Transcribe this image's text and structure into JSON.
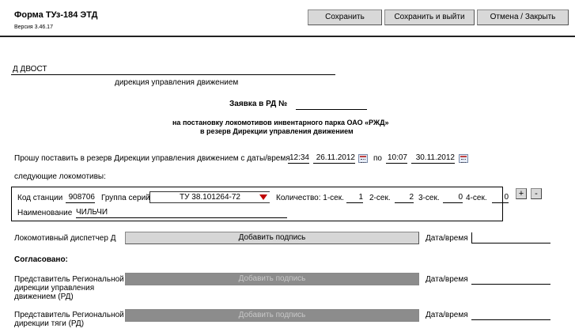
{
  "header": {
    "title": "Форма ТУз-184 ЭТД",
    "version": "Версия 3.46.17"
  },
  "toolbar": {
    "save_label": "Сохранить",
    "save_exit_label": "Сохранить и выйти",
    "cancel_label": "Отмена / Закрыть"
  },
  "form": {
    "depot_code": "Д ДВОСТ",
    "directorate_caption": "дирекция управления движением",
    "request_title": "Заявка в РД №",
    "request_number": "",
    "subtitle_line1": "на постановку  локомотивов  инвентарного парка ОАО «РЖД»",
    "subtitle_line2": "в резерв Дирекции управления движением",
    "request_text": "Прошу  поставить в резерв Дирекции управления движением с даты/время",
    "from_time": "12:34",
    "from_date": "26.11.2012",
    "to_label": "по",
    "to_time": "10:07",
    "to_date": "30.11.2012",
    "following_text": "следующие локомотивы:"
  },
  "locomotive": {
    "station_label": "Код станции",
    "station_code": "908706",
    "series_group_label": "Группа серий",
    "series_group_value": "ТУ 38.101264-72",
    "quantity_label": "Количество: 1-сек.",
    "sec1_value": "1",
    "sec2_label": "2-сек.",
    "sec2_value": "2",
    "sec3_label": "3-сек.",
    "sec3_value": "0",
    "sec4_label": "4-сек.",
    "sec4_value": "0",
    "name_label": "Наименование",
    "name_value": "ЧИЛЬЧИ",
    "add_label": "+",
    "remove_label": "-"
  },
  "signatures": {
    "dispatcher_label": "Локомотивный диспетчер Д",
    "add_signature_label": "Добавить подпись",
    "datetime_label": "Дата/время",
    "agreed_label": "Согласовано:",
    "rep_rd_line1": "Представитель Региональной",
    "rep_rd_line2": "дирекции управления",
    "rep_rd_line3": "движением (РД)",
    "rep_rt_line1": "Представитель Региональной",
    "rep_rt_line2": "дирекции тяги (РД)"
  }
}
